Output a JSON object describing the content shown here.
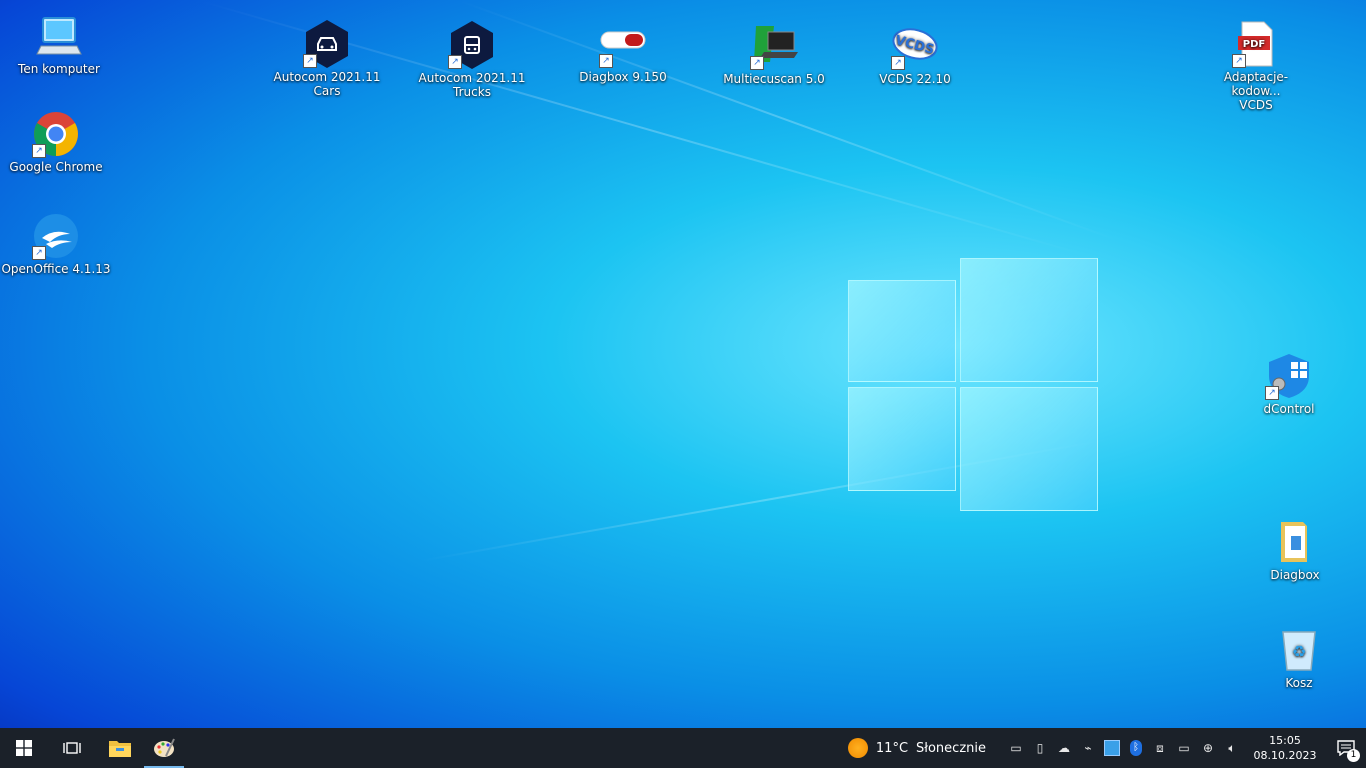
{
  "desktop": {
    "icons": [
      {
        "label": "Ten komputer"
      },
      {
        "label": "Google Chrome"
      },
      {
        "label": "OpenOffice 4.1.13"
      },
      {
        "label": "Autocom 2021.11\nCars"
      },
      {
        "label": "Autocom 2021.11\nTrucks"
      },
      {
        "label": "Diagbox 9.150"
      },
      {
        "label": "Multiecuscan 5.0"
      },
      {
        "label": "VCDS 22.10"
      },
      {
        "label": "Adaptacje-kodow...\nVCDS"
      },
      {
        "label": "dControl"
      },
      {
        "label": "Diagbox"
      },
      {
        "label": "Kosz"
      }
    ],
    "pdf_badge": "PDF",
    "vcds_badge": "VCDS"
  },
  "taskbar": {
    "weather": {
      "temp": "11°C",
      "condition": "Słonecznie"
    },
    "clock": {
      "time": "15:05",
      "date": "08.10.2023"
    },
    "notification_count": "1"
  },
  "colors": {
    "taskbar": "#1b2129",
    "accent": "#76b9ed"
  }
}
